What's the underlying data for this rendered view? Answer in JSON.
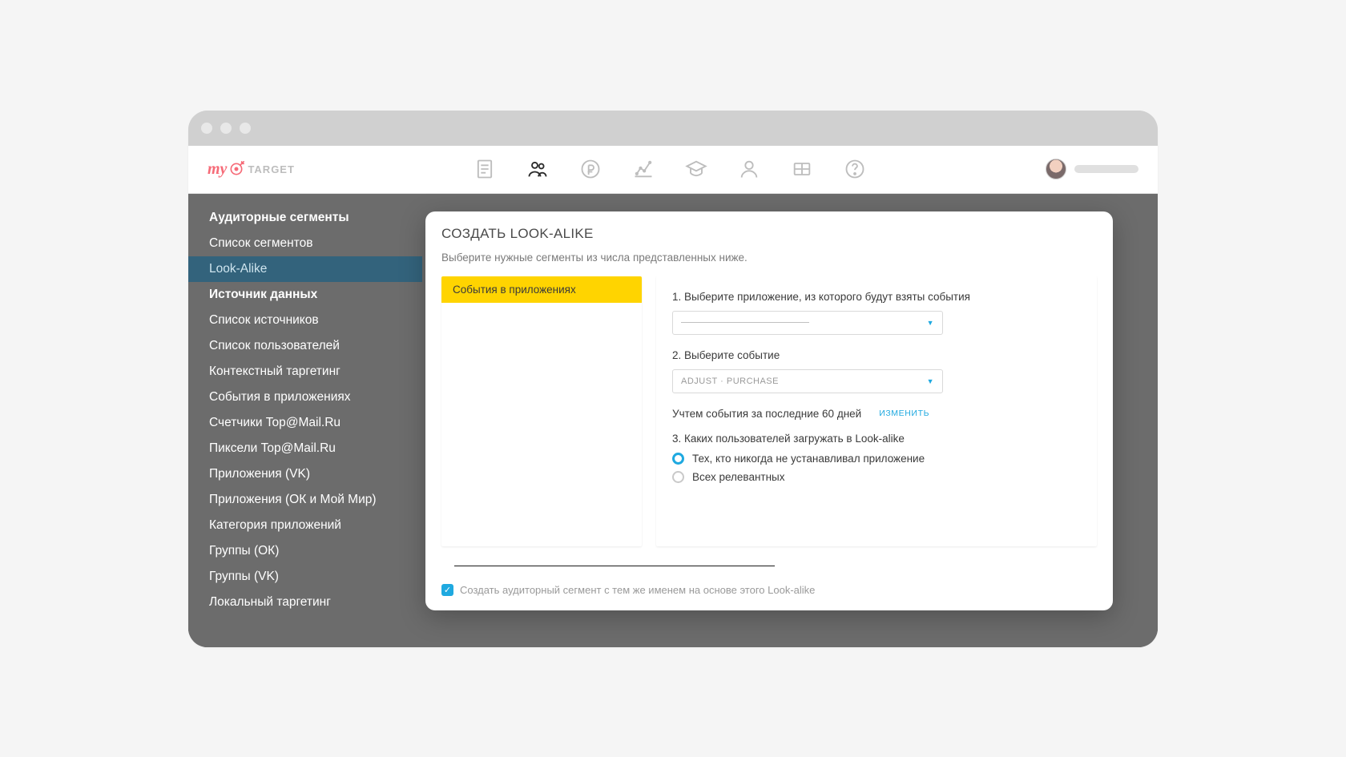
{
  "logo": {
    "first": "my",
    "second": "TARGET"
  },
  "sidebar": {
    "items": [
      {
        "label": "Аудиторные сегменты",
        "heading": true
      },
      {
        "label": "Список сегментов"
      },
      {
        "label": "Look-Alike",
        "selected": true
      },
      {
        "label": "Источник данных",
        "heading": true
      },
      {
        "label": "Список источников"
      },
      {
        "label": "Список пользователей"
      },
      {
        "label": "Контекстный таргетинг"
      },
      {
        "label": "События в приложениях"
      },
      {
        "label": "Счетчики Top@Mail.Ru"
      },
      {
        "label": "Пиксели Top@Mail.Ru"
      },
      {
        "label": "Приложения (VK)"
      },
      {
        "label": "Приложения (ОК и Мой Мир)"
      },
      {
        "label": "Категория приложений"
      },
      {
        "label": "Группы (ОК)"
      },
      {
        "label": "Группы (VK)"
      },
      {
        "label": "Локальный таргетинг"
      }
    ]
  },
  "modal": {
    "title": "СОЗДАТЬ LOOK-ALIKE",
    "subtitle": "Выберите нужные сегменты из числа представленных ниже.",
    "source_tab": "События в приложениях",
    "step1_label": "1. Выберите приложение, из которого будут взяты события",
    "step1_value": "",
    "step2_label": "2. Выберите событие",
    "step2_value": "ADJUST · PURCHASE",
    "period_text": "Учтем события за последние 60 дней",
    "change_label": "ИЗМЕНИТЬ",
    "step3_label": "3. Каких пользователей загружать в Look-alike",
    "radio1_label": "Тех, кто никогда не устанавливал приложение",
    "radio2_label": "Всех релевантных",
    "checkbox_label": "Создать аудиторный сегмент с тем же именем на основе этого Look-alike"
  }
}
